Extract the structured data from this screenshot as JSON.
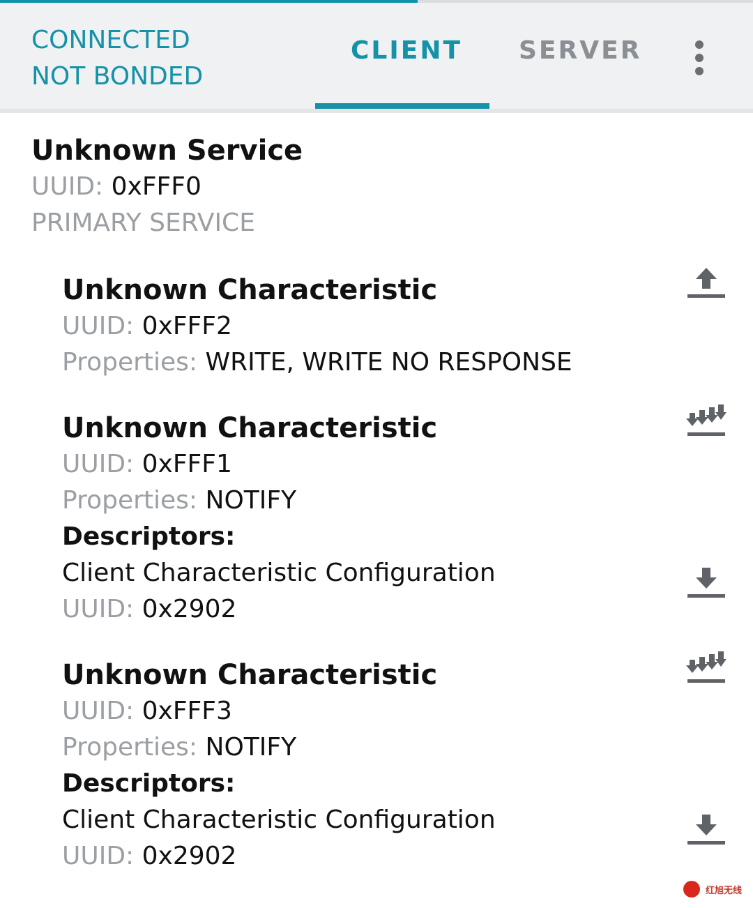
{
  "progress": {
    "fraction": 0.555
  },
  "header": {
    "status_line1": "CONNECTED",
    "status_line2": "NOT BONDED",
    "tabs": [
      {
        "label": "CLIENT",
        "selected": true
      },
      {
        "label": "SERVER",
        "selected": false
      }
    ],
    "menu_icon": "more-vert-icon",
    "accent_color": "#1592a8"
  },
  "service": {
    "name": "Unknown Service",
    "uuid_label": "UUID:",
    "uuid": "0xFFF0",
    "type": "PRIMARY SERVICE"
  },
  "characteristics": [
    {
      "name": "Unknown Characteristic",
      "uuid_label": "UUID:",
      "uuid": "0xFFF2",
      "properties_label": "Properties:",
      "properties": "WRITE, WRITE NO RESPONSE",
      "action_icon": "upload-icon"
    },
    {
      "name": "Unknown Characteristic",
      "uuid_label": "UUID:",
      "uuid": "0xFFF1",
      "properties_label": "Properties:",
      "properties": "NOTIFY",
      "action_icon": "notify-icon",
      "descriptors_label": "Descriptors:",
      "descriptor": {
        "name": "Client Characteristic Configuration",
        "uuid_label": "UUID:",
        "uuid": "0x2902",
        "action_icon": "download-icon"
      }
    },
    {
      "name": "Unknown Characteristic",
      "uuid_label": "UUID:",
      "uuid": "0xFFF3",
      "properties_label": "Properties:",
      "properties": "NOTIFY",
      "action_icon": "notify-icon",
      "descriptors_label": "Descriptors:",
      "descriptor": {
        "name": "Client Characteristic Configuration",
        "uuid_label": "UUID:",
        "uuid": "0x2902",
        "action_icon": "download-icon"
      }
    }
  ],
  "watermark": {
    "text": "红旭无线"
  }
}
